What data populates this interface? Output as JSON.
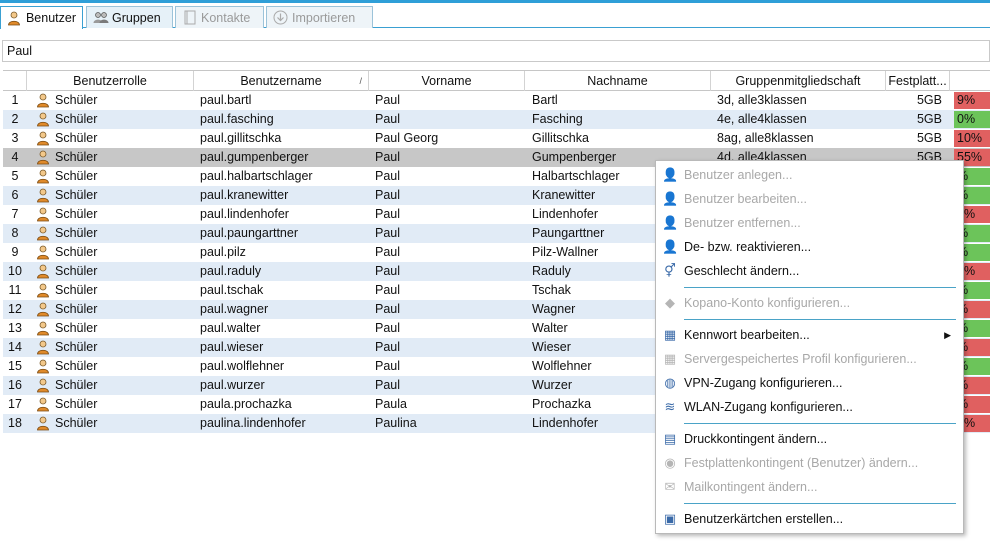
{
  "tabs": [
    {
      "label": "Benutzer",
      "icon": "user-icon",
      "active": true,
      "disabled": false
    },
    {
      "label": "Gruppen",
      "icon": "group-icon",
      "active": false,
      "disabled": false
    },
    {
      "label": "Kontakte",
      "icon": "contacts-book-icon",
      "active": false,
      "disabled": true
    },
    {
      "label": "Importieren",
      "icon": "import-icon",
      "active": false,
      "disabled": true
    }
  ],
  "search": {
    "value": "Paul"
  },
  "table": {
    "columns": [
      "Benutzerrolle",
      "Benutzername",
      "Vorname",
      "Nachname",
      "Gruppenmitgliedschaft",
      "Festplatt...",
      ""
    ],
    "sort_indicator": "/",
    "rows": [
      {
        "n": "1",
        "role": "Schüler",
        "user": "paul.bartl",
        "first": "Paul",
        "last": "Bartl",
        "groups": "3d, alle3klassen",
        "quota": "5GB",
        "pct": "9%",
        "level": "red"
      },
      {
        "n": "2",
        "role": "Schüler",
        "user": "paul.fasching",
        "first": "Paul",
        "last": "Fasching",
        "groups": "4e, alle4klassen",
        "quota": "5GB",
        "pct": "0%",
        "level": "green"
      },
      {
        "n": "3",
        "role": "Schüler",
        "user": "paul.gillitschka",
        "first": "Paul Georg",
        "last": "Gillitschka",
        "groups": "8ag, alle8klassen",
        "quota": "5GB",
        "pct": "10%",
        "level": "red"
      },
      {
        "n": "4",
        "role": "Schüler",
        "user": "paul.gumpenberger",
        "first": "Paul",
        "last": "Gumpenberger",
        "groups": "4d, alle4klassen",
        "quota": "5GB",
        "pct": "55%",
        "level": "red"
      },
      {
        "n": "5",
        "role": "Schüler",
        "user": "paul.halbartschlager",
        "first": "Paul",
        "last": "Halbartschlager",
        "groups": "",
        "quota": "",
        "pct": "%",
        "level": "green"
      },
      {
        "n": "6",
        "role": "Schüler",
        "user": "paul.kranewitter",
        "first": "Paul",
        "last": "Kranewitter",
        "groups": "",
        "quota": "",
        "pct": "%",
        "level": "green"
      },
      {
        "n": "7",
        "role": "Schüler",
        "user": "paul.lindenhofer",
        "first": "Paul",
        "last": "Lindenhofer",
        "groups": "",
        "quota": "",
        "pct": "6%",
        "level": "red"
      },
      {
        "n": "8",
        "role": "Schüler",
        "user": "paul.paungarttner",
        "first": "Paul",
        "last": "Paungarttner",
        "groups": "",
        "quota": "",
        "pct": "%",
        "level": "green"
      },
      {
        "n": "9",
        "role": "Schüler",
        "user": "paul.pilz",
        "first": "Paul",
        "last": "Pilz-Wallner",
        "groups": "",
        "quota": "",
        "pct": "%",
        "level": "green"
      },
      {
        "n": "10",
        "role": "Schüler",
        "user": "paul.raduly",
        "first": "Paul",
        "last": "Raduly",
        "groups": "",
        "quota": "",
        "pct": "3%",
        "level": "red"
      },
      {
        "n": "11",
        "role": "Schüler",
        "user": "paul.tschak",
        "first": "Paul",
        "last": "Tschak",
        "groups": "",
        "quota": "",
        "pct": "%",
        "level": "green"
      },
      {
        "n": "12",
        "role": "Schüler",
        "user": "paul.wagner",
        "first": "Paul",
        "last": "Wagner",
        "groups": "",
        "quota": "",
        "pct": "%",
        "level": "red"
      },
      {
        "n": "13",
        "role": "Schüler",
        "user": "paul.walter",
        "first": "Paul",
        "last": "Walter",
        "groups": "",
        "quota": "",
        "pct": "%",
        "level": "green"
      },
      {
        "n": "14",
        "role": "Schüler",
        "user": "paul.wieser",
        "first": "Paul",
        "last": "Wieser",
        "groups": "",
        "quota": "",
        "pct": "%",
        "level": "red"
      },
      {
        "n": "15",
        "role": "Schüler",
        "user": "paul.wolflehner",
        "first": "Paul",
        "last": "Wolflehner",
        "groups": "",
        "quota": "",
        "pct": "%",
        "level": "green"
      },
      {
        "n": "16",
        "role": "Schüler",
        "user": "paul.wurzer",
        "first": "Paul",
        "last": "Wurzer",
        "groups": "",
        "quota": "",
        "pct": "%",
        "level": "red"
      },
      {
        "n": "17",
        "role": "Schüler",
        "user": "paula.prochazka",
        "first": "Paula",
        "last": "Prochazka",
        "groups": "",
        "quota": "",
        "pct": "%",
        "level": "red"
      },
      {
        "n": "18",
        "role": "Schüler",
        "user": "paulina.lindenhofer",
        "first": "Paulina",
        "last": "Lindenhofer",
        "groups": "",
        "quota": "",
        "pct": "4%",
        "level": "red"
      }
    ],
    "selected_row": 4
  },
  "context_menu": {
    "items": [
      {
        "label": "Benutzer anlegen...",
        "icon": "add-user-icon",
        "disabled": true
      },
      {
        "label": "Benutzer bearbeiten...",
        "icon": "edit-user-icon",
        "disabled": true
      },
      {
        "label": "Benutzer entfernen...",
        "icon": "remove-user-icon",
        "disabled": true
      },
      {
        "label": "De- bzw. reaktivieren...",
        "icon": "toggle-user-icon",
        "disabled": false
      },
      {
        "label": "Geschlecht ändern...",
        "icon": "gender-icon",
        "disabled": false
      },
      {
        "sep": true
      },
      {
        "label": "Kopano-Konto konfigurieren...",
        "icon": "kopano-icon",
        "disabled": true
      },
      {
        "sep": true
      },
      {
        "label": "Kennwort bearbeiten...",
        "icon": "password-icon",
        "disabled": false,
        "submenu": true
      },
      {
        "label": "Servergespeichertes Profil konfigurieren...",
        "icon": "server-profile-icon",
        "disabled": true
      },
      {
        "label": "VPN-Zugang konfigurieren...",
        "icon": "vpn-globe-icon",
        "disabled": false
      },
      {
        "label": "WLAN-Zugang konfigurieren...",
        "icon": "wifi-icon",
        "disabled": false
      },
      {
        "sep": true
      },
      {
        "label": "Druckkontingent ändern...",
        "icon": "printer-icon",
        "disabled": false
      },
      {
        "label": "Festplattenkontingent (Benutzer) ändern...",
        "icon": "disk-quota-icon",
        "disabled": true
      },
      {
        "label": "Mailkontingent ändern...",
        "icon": "mail-icon",
        "disabled": true
      },
      {
        "sep": true
      },
      {
        "label": "Benutzerkärtchen erstellen...",
        "icon": "user-card-icon",
        "disabled": false
      }
    ]
  },
  "colors": {
    "accent": "#2f9fd8",
    "row_alt": "#e1ebf6",
    "row_selected": "#c7c7c7",
    "quota_red": "#e06060",
    "quota_green": "#6cc45a"
  }
}
